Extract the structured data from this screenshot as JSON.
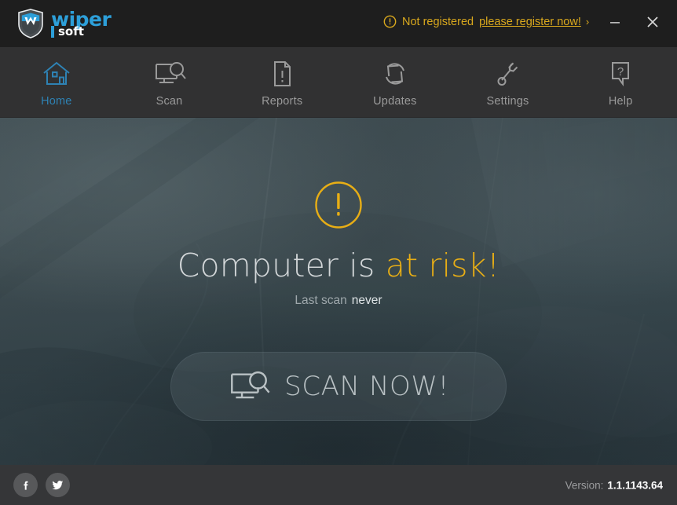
{
  "titlebar": {
    "logo": {
      "icon": "shield-w-icon",
      "primary": "wiper",
      "secondary": "soft"
    },
    "registration": {
      "icon": "alert-circle-icon",
      "status_text": "Not registered",
      "link_text": "please register now!",
      "chevron": "›",
      "color": "#d9a81d"
    },
    "window_controls": {
      "minimize": "minimize-icon",
      "close": "close-icon"
    }
  },
  "nav": {
    "active_index": 0,
    "accent_color": "#2e82b4",
    "items": [
      {
        "label": "Home",
        "icon": "house-icon"
      },
      {
        "label": "Scan",
        "icon": "monitor-search-icon"
      },
      {
        "label": "Reports",
        "icon": "document-alert-icon"
      },
      {
        "label": "Updates",
        "icon": "refresh-sync-icon"
      },
      {
        "label": "Settings",
        "icon": "wrench-icon"
      },
      {
        "label": "Help",
        "icon": "speech-question-icon"
      }
    ]
  },
  "hero": {
    "alert_icon": "alert-circle-large-icon",
    "alert_color": "#e8ae15",
    "status_prefix": "Computer is",
    "status_highlight": "at risk!",
    "last_scan_label": "Last scan",
    "last_scan_value": "never",
    "scan_button": {
      "label": "SCAN NOW!",
      "icon": "monitor-search-icon"
    }
  },
  "footer": {
    "social": [
      {
        "name": "facebook-icon",
        "label": "f"
      },
      {
        "name": "twitter-icon",
        "label": "t"
      }
    ],
    "version_label": "Version:",
    "version_value": "1.1.1143.64"
  }
}
